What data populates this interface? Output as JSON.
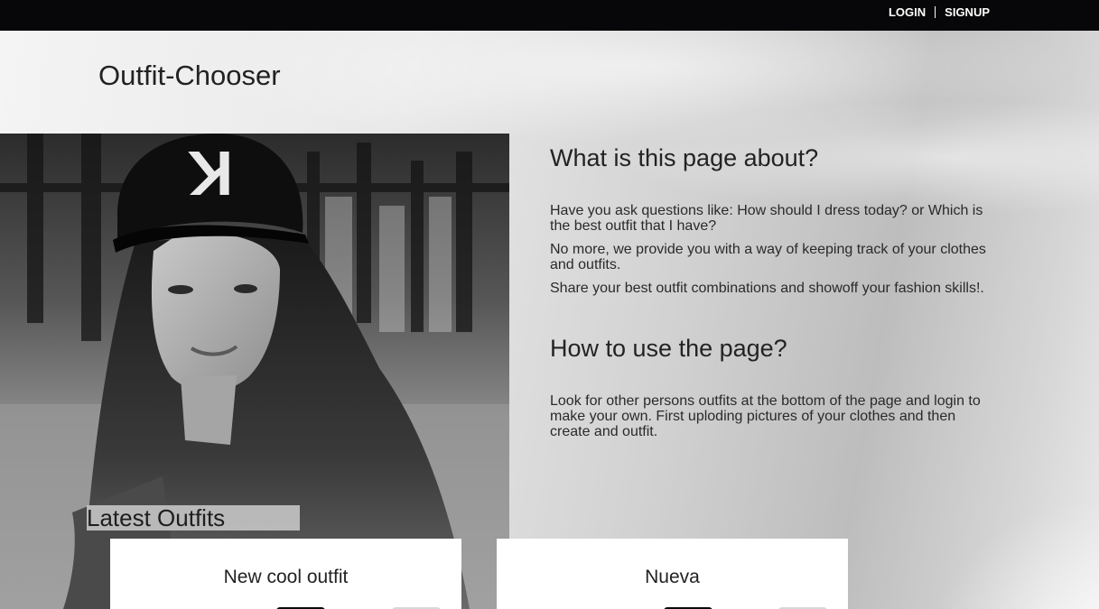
{
  "topnav": {
    "login": "LOGIN",
    "signup": "SIGNUP"
  },
  "site": {
    "title": "Outfit-Chooser"
  },
  "hero": {
    "cap_letter": "K"
  },
  "about": {
    "heading": "What is this page about?",
    "paragraphs": [
      "Have you ask questions like: How should I dress today? or Which is the best outfit that I have?",
      "No more, we provide you with a way of keeping track of your clothes and outfits.",
      "Share your best outfit combinations and showoff your fashion skills!."
    ]
  },
  "howto": {
    "heading": "How to use the page?",
    "text": "Look for other persons outfits at the bottom of the page and login to make your own. First uploding pictures of your clothes and then create and outfit."
  },
  "latest": {
    "heading": "Latest Outfits",
    "outfits": [
      {
        "title": "New cool outfit"
      },
      {
        "title": "Nueva"
      }
    ]
  },
  "colors": {
    "topbar": "#070709",
    "card": "#ffffff",
    "text": "#222222"
  }
}
